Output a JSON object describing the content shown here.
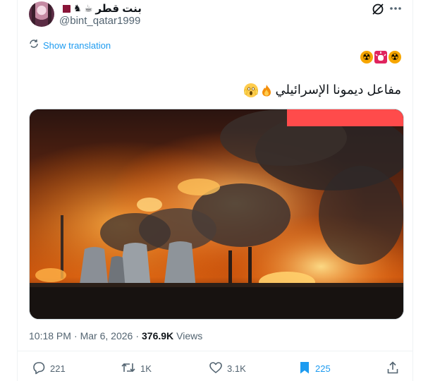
{
  "author": {
    "display_name": "بنت قطر",
    "handle": "@bint_qatar1999",
    "name_emojis": [
      "☕",
      "♞"
    ]
  },
  "show_translation": "Show translation",
  "tweet": {
    "text": "مفاعل ديمونا الإسرائيلي"
  },
  "meta": {
    "time": "10:18 PM",
    "separator": "·",
    "date": "Mar 6, 2026",
    "separator2": "·",
    "views_count": "376.9K",
    "views_label": "Views"
  },
  "actions": {
    "replies": "221",
    "reposts": "1K",
    "likes": "3.1K",
    "bookmarks": "225"
  },
  "colors": {
    "accent": "#1d9bf0",
    "muted": "#536471",
    "text": "#0f1419"
  }
}
